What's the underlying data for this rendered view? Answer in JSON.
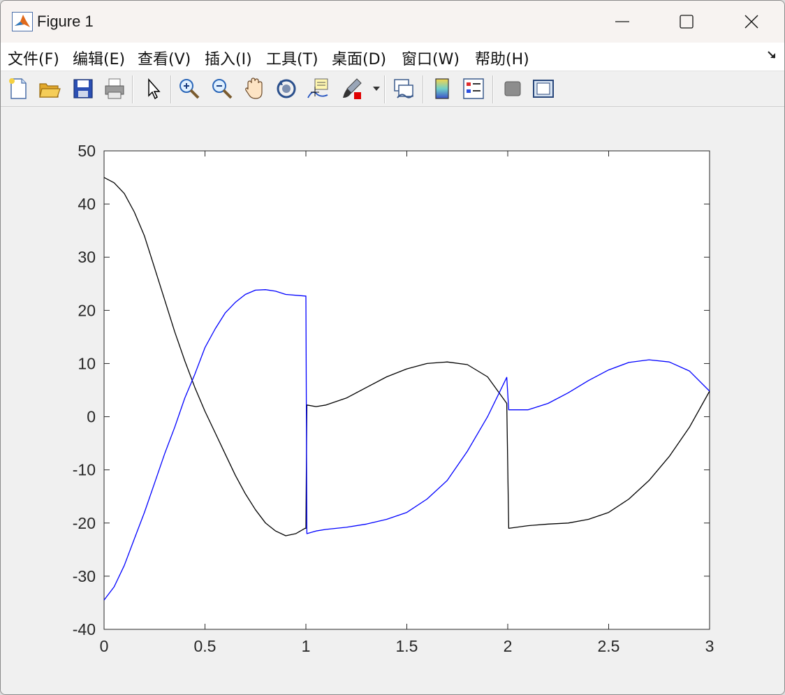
{
  "window": {
    "title": "Figure 1",
    "icon": "matlab-icon"
  },
  "menu": [
    {
      "id": "file",
      "label": "文件(F)"
    },
    {
      "id": "edit",
      "label": "编辑(E)"
    },
    {
      "id": "view",
      "label": "查看(V)"
    },
    {
      "id": "insert",
      "label": "插入(I)"
    },
    {
      "id": "tools",
      "label": "工具(T)"
    },
    {
      "id": "desktop",
      "label": "桌面(D)"
    },
    {
      "id": "window",
      "label": "窗口(W)"
    },
    {
      "id": "help",
      "label": "帮助(H)"
    }
  ],
  "toolbar": [
    {
      "icon": "new-figure-icon"
    },
    {
      "icon": "open-file-icon"
    },
    {
      "icon": "save-icon"
    },
    {
      "icon": "print-icon"
    },
    {
      "icon": "pointer-icon"
    },
    {
      "icon": "zoom-in-icon"
    },
    {
      "icon": "zoom-out-icon"
    },
    {
      "icon": "pan-hand-icon"
    },
    {
      "icon": "rotate-3d-icon"
    },
    {
      "icon": "data-cursor-icon"
    },
    {
      "icon": "brush-icon"
    },
    {
      "icon": "link-plot-icon"
    },
    {
      "icon": "colorbar-icon"
    },
    {
      "icon": "legend-icon"
    },
    {
      "icon": "hide-plot-tools-icon"
    },
    {
      "icon": "show-plot-tools-icon"
    }
  ],
  "colors": {
    "series1": "#000000",
    "series2": "#0000ff",
    "axes_bg": "#ffffff",
    "figure_bg": "#f0f0f0"
  },
  "chart_data": {
    "type": "line",
    "xlim": [
      0,
      3
    ],
    "ylim": [
      -40,
      50
    ],
    "xticks": [
      0,
      0.5,
      1,
      1.5,
      2,
      2.5,
      3
    ],
    "xtick_labels": [
      "0",
      "0.5",
      "1",
      "1.5",
      "2",
      "2.5",
      "3"
    ],
    "yticks": [
      -40,
      -30,
      -20,
      -10,
      0,
      10,
      20,
      30,
      40,
      50
    ],
    "ytick_labels": [
      "-40",
      "-30",
      "-20",
      "-10",
      "0",
      "10",
      "20",
      "30",
      "40",
      "50"
    ],
    "grid": false,
    "series": [
      {
        "color": "#000000",
        "points": [
          [
            0,
            45
          ],
          [
            0.05,
            44
          ],
          [
            0.1,
            42
          ],
          [
            0.15,
            38.5
          ],
          [
            0.2,
            34
          ],
          [
            0.25,
            28
          ],
          [
            0.3,
            22
          ],
          [
            0.35,
            16
          ],
          [
            0.4,
            10.5
          ],
          [
            0.45,
            5.5
          ],
          [
            0.5,
            1
          ],
          [
            0.55,
            -3
          ],
          [
            0.6,
            -7
          ],
          [
            0.65,
            -11
          ],
          [
            0.7,
            -14.5
          ],
          [
            0.75,
            -17.5
          ],
          [
            0.8,
            -20
          ],
          [
            0.85,
            -21.5
          ],
          [
            0.9,
            -22.4
          ],
          [
            0.95,
            -22
          ],
          [
            0.995,
            -21
          ],
          [
            1.0,
            -21
          ],
          [
            1.005,
            2.2
          ],
          [
            1.05,
            1.9
          ],
          [
            1.1,
            2.2
          ],
          [
            1.2,
            3.5
          ],
          [
            1.3,
            5.5
          ],
          [
            1.4,
            7.5
          ],
          [
            1.5,
            9
          ],
          [
            1.6,
            10
          ],
          [
            1.7,
            10.3
          ],
          [
            1.8,
            9.8
          ],
          [
            1.9,
            7.5
          ],
          [
            1.995,
            2.5
          ],
          [
            2.005,
            -21
          ],
          [
            2.1,
            -20.5
          ],
          [
            2.2,
            -20.2
          ],
          [
            2.3,
            -20
          ],
          [
            2.4,
            -19.3
          ],
          [
            2.5,
            -18
          ],
          [
            2.6,
            -15.5
          ],
          [
            2.7,
            -12
          ],
          [
            2.8,
            -7.5
          ],
          [
            2.9,
            -2
          ],
          [
            3.0,
            4.8
          ]
        ]
      },
      {
        "color": "#0000ff",
        "points": [
          [
            0,
            -34.5
          ],
          [
            0.05,
            -32
          ],
          [
            0.1,
            -28
          ],
          [
            0.15,
            -23
          ],
          [
            0.2,
            -18
          ],
          [
            0.25,
            -12.5
          ],
          [
            0.3,
            -7
          ],
          [
            0.35,
            -2
          ],
          [
            0.4,
            3.5
          ],
          [
            0.45,
            8
          ],
          [
            0.5,
            13
          ],
          [
            0.55,
            16.5
          ],
          [
            0.6,
            19.5
          ],
          [
            0.65,
            21.5
          ],
          [
            0.7,
            23
          ],
          [
            0.75,
            23.8
          ],
          [
            0.8,
            23.9
          ],
          [
            0.85,
            23.6
          ],
          [
            0.9,
            23
          ],
          [
            0.995,
            22.7
          ],
          [
            1.0,
            22.7
          ],
          [
            1.005,
            -22
          ],
          [
            1.05,
            -21.5
          ],
          [
            1.1,
            -21.2
          ],
          [
            1.2,
            -20.8
          ],
          [
            1.3,
            -20.2
          ],
          [
            1.4,
            -19.3
          ],
          [
            1.5,
            -18
          ],
          [
            1.6,
            -15.5
          ],
          [
            1.7,
            -12
          ],
          [
            1.8,
            -6.5
          ],
          [
            1.9,
            0
          ],
          [
            1.995,
            7.4
          ],
          [
            2.005,
            1.3
          ],
          [
            2.1,
            1.3
          ],
          [
            2.2,
            2.5
          ],
          [
            2.3,
            4.5
          ],
          [
            2.4,
            6.8
          ],
          [
            2.5,
            8.8
          ],
          [
            2.6,
            10.2
          ],
          [
            2.7,
            10.7
          ],
          [
            2.8,
            10.3
          ],
          [
            2.9,
            8.6
          ],
          [
            3.0,
            4.8
          ]
        ]
      }
    ]
  }
}
